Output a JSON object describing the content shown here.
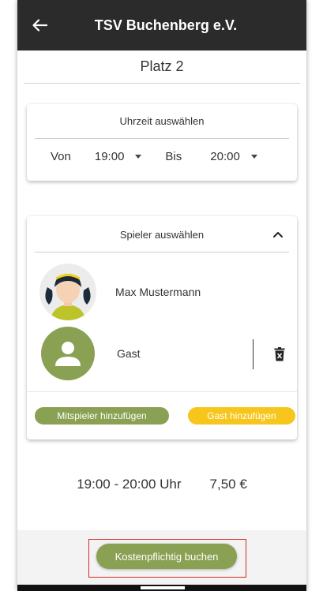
{
  "header": {
    "title": "TSV Buchenberg e.V.",
    "back_icon": "arrow-left-icon"
  },
  "court": {
    "title": "Platz 2"
  },
  "time_card": {
    "title": "Uhrzeit auswählen",
    "from_label": "Von",
    "from_value": "19:00",
    "to_label": "Bis",
    "to_value": "20:00"
  },
  "players_card": {
    "title": "Spieler auswählen",
    "players": [
      {
        "name": "Max Mustermann",
        "avatar": "girl-avatar-icon"
      },
      {
        "name": "Gast",
        "avatar": "person-icon"
      }
    ],
    "add_player_label": "Mitspieler hinzufügen",
    "add_guest_label": "Gast hinzufügen"
  },
  "summary": {
    "time_range": "19:00 - 20:00 Uhr",
    "price": "7,50 €"
  },
  "footer": {
    "book_label": "Kostenpflichtig buchen"
  },
  "colors": {
    "appbar": "#2b2b2b",
    "accent_green": "#8aa052",
    "accent_yellow": "#f6c61c",
    "highlight_red": "#d12a2a"
  }
}
